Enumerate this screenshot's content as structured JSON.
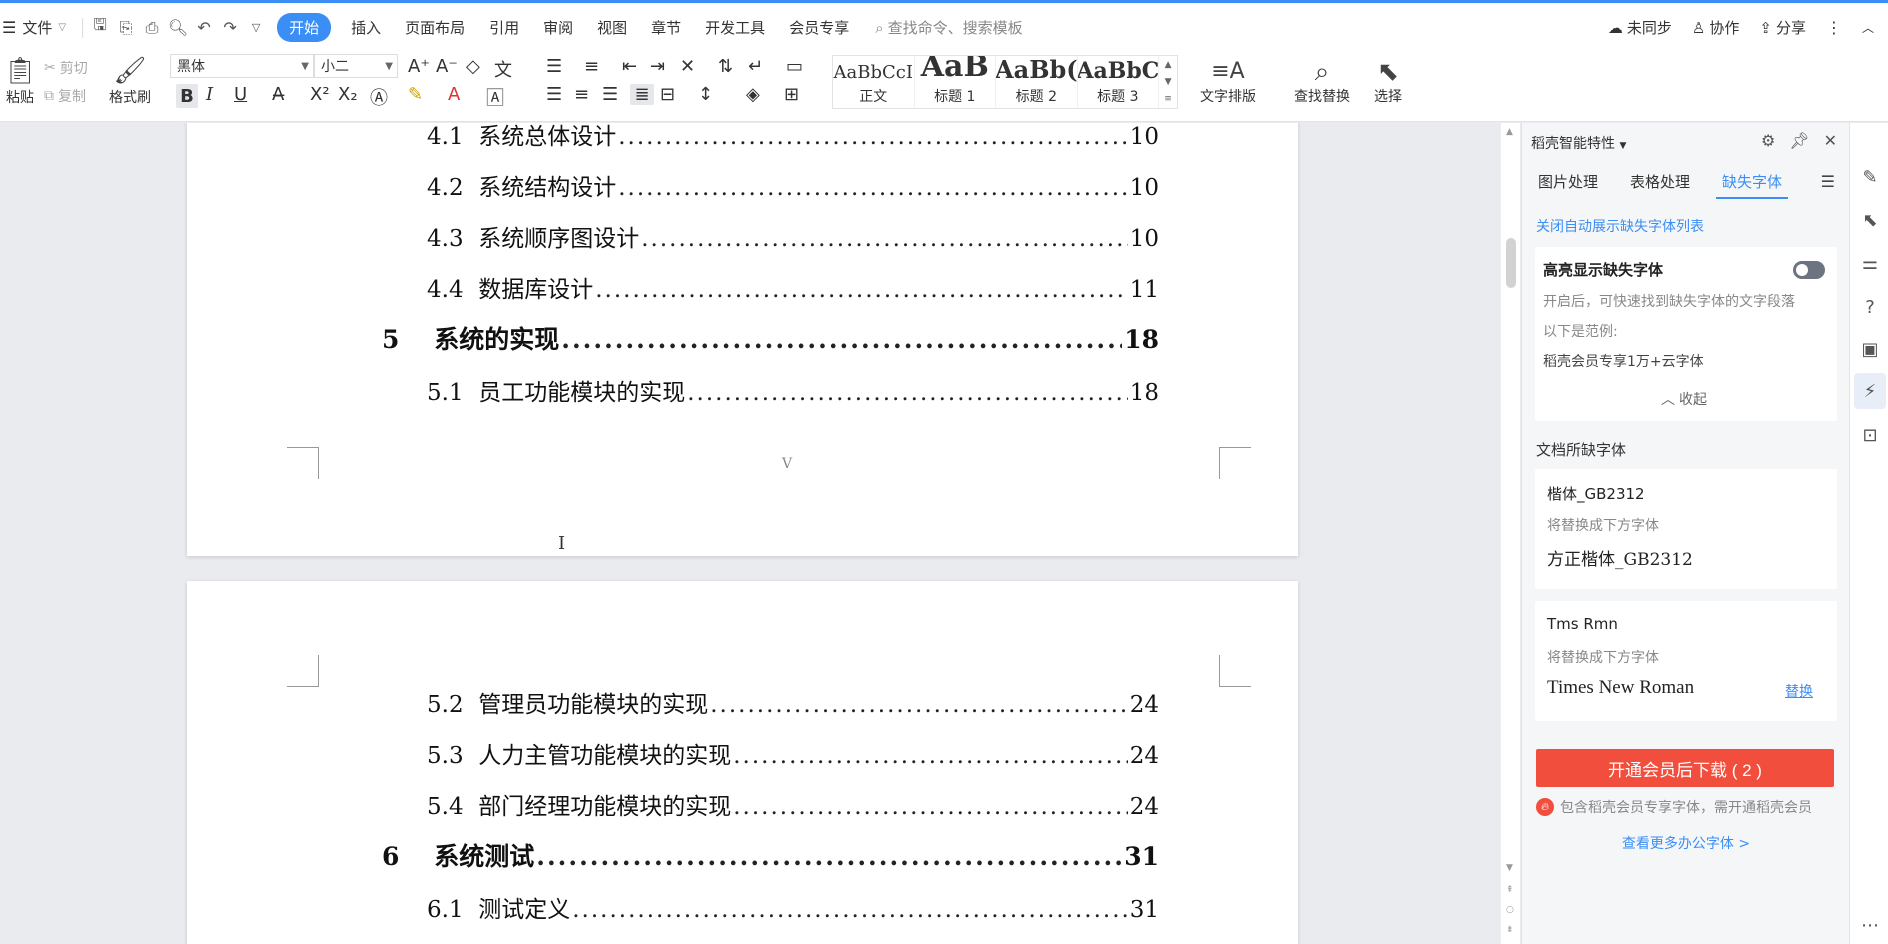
{
  "menubar": {
    "file_label": "文件",
    "tabs": [
      "插入",
      "页面布局",
      "引用",
      "审阅",
      "视图",
      "章节",
      "开发工具",
      "会员专享"
    ],
    "active_tab": "开始",
    "search_placeholder": "查找命令、搜索模板",
    "sync_label": "未同步",
    "collab_label": "协作",
    "share_label": "分享"
  },
  "ribbon": {
    "paste_label": "粘贴",
    "cut_label": "剪切",
    "copy_label": "复制",
    "format_painter_label": "格式刷",
    "font_name": "黑体",
    "font_size": "小二",
    "bold": "B",
    "italic": "I",
    "underline": "U",
    "styles": [
      {
        "sample": "AaBbCcI",
        "label": "正文",
        "size": 18
      },
      {
        "sample": "AaB",
        "label": "标题 1",
        "size": 30
      },
      {
        "sample": "AaBb(",
        "label": "标题 2",
        "size": 24
      },
      {
        "sample": "AaBbC",
        "label": "标题 3",
        "size": 22
      }
    ],
    "text_layout_label": "文字排版",
    "find_replace_label": "查找替换",
    "select_label": "选择"
  },
  "document": {
    "page1_entries": [
      {
        "num": "4.1",
        "title": "系统总体设计",
        "page": "10"
      },
      {
        "num": "4.2",
        "title": "系统结构设计",
        "page": "10"
      },
      {
        "num": "4.3",
        "title": "系统顺序图设计",
        "page": "10"
      },
      {
        "num": "4.4",
        "title": "数据库设计",
        "page": "11"
      }
    ],
    "chapter5": {
      "num": "5",
      "title": "系统的实现",
      "page": "18"
    },
    "entry_5_1": {
      "num": "5.1",
      "title": "员工功能模块的实现",
      "page": "18"
    },
    "page_footer": "V",
    "page2_entries": [
      {
        "num": "5.2",
        "title": "管理员功能模块的实现",
        "page": "24"
      },
      {
        "num": "5.3",
        "title": "人力主管功能模块的实现",
        "page": "24"
      },
      {
        "num": "5.4",
        "title": "部门经理功能模块的实现",
        "page": "24"
      }
    ],
    "chapter6": {
      "num": "6",
      "title": "系统测试",
      "page": "31"
    },
    "entry_6_1": {
      "num": "6.1",
      "title": "测试定义",
      "page": "31"
    },
    "dots": "................................................................................................................................"
  },
  "panel": {
    "title": "稻壳智能特性",
    "tabs": [
      "图片处理",
      "表格处理",
      "缺失字体"
    ],
    "active_tab": "缺失字体",
    "close_list_link": "关闭自动展示缺失字体列表",
    "highlight_title": "高亮显示缺失字体",
    "highlight_desc": "开启后，可快速找到缺失字体的文字段落",
    "example_label": "以下是范例:",
    "example_text": "稻壳会员专享1万+云字体",
    "collapse_label": "收起",
    "missing_section_title": "文档所缺字体",
    "fonts": [
      {
        "name": "楷体_GB2312",
        "hint": "将替换成下方字体",
        "replacement": "方正楷体_GB2312"
      },
      {
        "name": "Tms Rmn",
        "hint": "将替换成下方字体",
        "replacement": "Times New Roman",
        "action": "替换"
      }
    ],
    "download_button": "开通会员后下载 ( 2 )",
    "note": "包含稻壳会员专享字体，需开通稻壳会员",
    "more_link": "查看更多办公字体 >"
  }
}
